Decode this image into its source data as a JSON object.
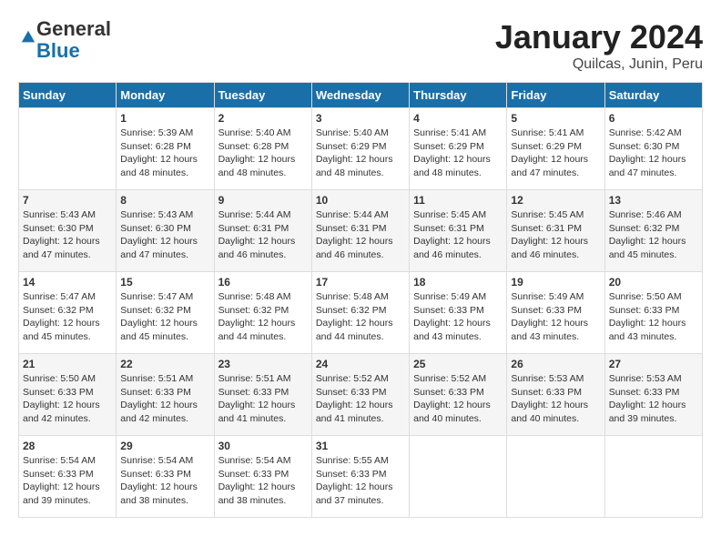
{
  "logo": {
    "general": "General",
    "blue": "Blue"
  },
  "title": "January 2024",
  "subtitle": "Quilcas, Junin, Peru",
  "days_header": [
    "Sunday",
    "Monday",
    "Tuesday",
    "Wednesday",
    "Thursday",
    "Friday",
    "Saturday"
  ],
  "weeks": [
    [
      {
        "day": "",
        "sunrise": "",
        "sunset": "",
        "daylight": ""
      },
      {
        "day": "1",
        "sunrise": "5:39 AM",
        "sunset": "6:28 PM",
        "daylight": "12 hours and 48 minutes."
      },
      {
        "day": "2",
        "sunrise": "5:40 AM",
        "sunset": "6:28 PM",
        "daylight": "12 hours and 48 minutes."
      },
      {
        "day": "3",
        "sunrise": "5:40 AM",
        "sunset": "6:29 PM",
        "daylight": "12 hours and 48 minutes."
      },
      {
        "day": "4",
        "sunrise": "5:41 AM",
        "sunset": "6:29 PM",
        "daylight": "12 hours and 48 minutes."
      },
      {
        "day": "5",
        "sunrise": "5:41 AM",
        "sunset": "6:29 PM",
        "daylight": "12 hours and 47 minutes."
      },
      {
        "day": "6",
        "sunrise": "5:42 AM",
        "sunset": "6:30 PM",
        "daylight": "12 hours and 47 minutes."
      }
    ],
    [
      {
        "day": "7",
        "sunrise": "5:43 AM",
        "sunset": "6:30 PM",
        "daylight": "12 hours and 47 minutes."
      },
      {
        "day": "8",
        "sunrise": "5:43 AM",
        "sunset": "6:30 PM",
        "daylight": "12 hours and 47 minutes."
      },
      {
        "day": "9",
        "sunrise": "5:44 AM",
        "sunset": "6:31 PM",
        "daylight": "12 hours and 46 minutes."
      },
      {
        "day": "10",
        "sunrise": "5:44 AM",
        "sunset": "6:31 PM",
        "daylight": "12 hours and 46 minutes."
      },
      {
        "day": "11",
        "sunrise": "5:45 AM",
        "sunset": "6:31 PM",
        "daylight": "12 hours and 46 minutes."
      },
      {
        "day": "12",
        "sunrise": "5:45 AM",
        "sunset": "6:31 PM",
        "daylight": "12 hours and 46 minutes."
      },
      {
        "day": "13",
        "sunrise": "5:46 AM",
        "sunset": "6:32 PM",
        "daylight": "12 hours and 45 minutes."
      }
    ],
    [
      {
        "day": "14",
        "sunrise": "5:47 AM",
        "sunset": "6:32 PM",
        "daylight": "12 hours and 45 minutes."
      },
      {
        "day": "15",
        "sunrise": "5:47 AM",
        "sunset": "6:32 PM",
        "daylight": "12 hours and 45 minutes."
      },
      {
        "day": "16",
        "sunrise": "5:48 AM",
        "sunset": "6:32 PM",
        "daylight": "12 hours and 44 minutes."
      },
      {
        "day": "17",
        "sunrise": "5:48 AM",
        "sunset": "6:32 PM",
        "daylight": "12 hours and 44 minutes."
      },
      {
        "day": "18",
        "sunrise": "5:49 AM",
        "sunset": "6:33 PM",
        "daylight": "12 hours and 43 minutes."
      },
      {
        "day": "19",
        "sunrise": "5:49 AM",
        "sunset": "6:33 PM",
        "daylight": "12 hours and 43 minutes."
      },
      {
        "day": "20",
        "sunrise": "5:50 AM",
        "sunset": "6:33 PM",
        "daylight": "12 hours and 43 minutes."
      }
    ],
    [
      {
        "day": "21",
        "sunrise": "5:50 AM",
        "sunset": "6:33 PM",
        "daylight": "12 hours and 42 minutes."
      },
      {
        "day": "22",
        "sunrise": "5:51 AM",
        "sunset": "6:33 PM",
        "daylight": "12 hours and 42 minutes."
      },
      {
        "day": "23",
        "sunrise": "5:51 AM",
        "sunset": "6:33 PM",
        "daylight": "12 hours and 41 minutes."
      },
      {
        "day": "24",
        "sunrise": "5:52 AM",
        "sunset": "6:33 PM",
        "daylight": "12 hours and 41 minutes."
      },
      {
        "day": "25",
        "sunrise": "5:52 AM",
        "sunset": "6:33 PM",
        "daylight": "12 hours and 40 minutes."
      },
      {
        "day": "26",
        "sunrise": "5:53 AM",
        "sunset": "6:33 PM",
        "daylight": "12 hours and 40 minutes."
      },
      {
        "day": "27",
        "sunrise": "5:53 AM",
        "sunset": "6:33 PM",
        "daylight": "12 hours and 39 minutes."
      }
    ],
    [
      {
        "day": "28",
        "sunrise": "5:54 AM",
        "sunset": "6:33 PM",
        "daylight": "12 hours and 39 minutes."
      },
      {
        "day": "29",
        "sunrise": "5:54 AM",
        "sunset": "6:33 PM",
        "daylight": "12 hours and 38 minutes."
      },
      {
        "day": "30",
        "sunrise": "5:54 AM",
        "sunset": "6:33 PM",
        "daylight": "12 hours and 38 minutes."
      },
      {
        "day": "31",
        "sunrise": "5:55 AM",
        "sunset": "6:33 PM",
        "daylight": "12 hours and 37 minutes."
      },
      {
        "day": "",
        "sunrise": "",
        "sunset": "",
        "daylight": ""
      },
      {
        "day": "",
        "sunrise": "",
        "sunset": "",
        "daylight": ""
      },
      {
        "day": "",
        "sunrise": "",
        "sunset": "",
        "daylight": ""
      }
    ]
  ],
  "labels": {
    "sunrise_prefix": "Sunrise: ",
    "sunset_prefix": "Sunset: ",
    "daylight_prefix": "Daylight: "
  }
}
